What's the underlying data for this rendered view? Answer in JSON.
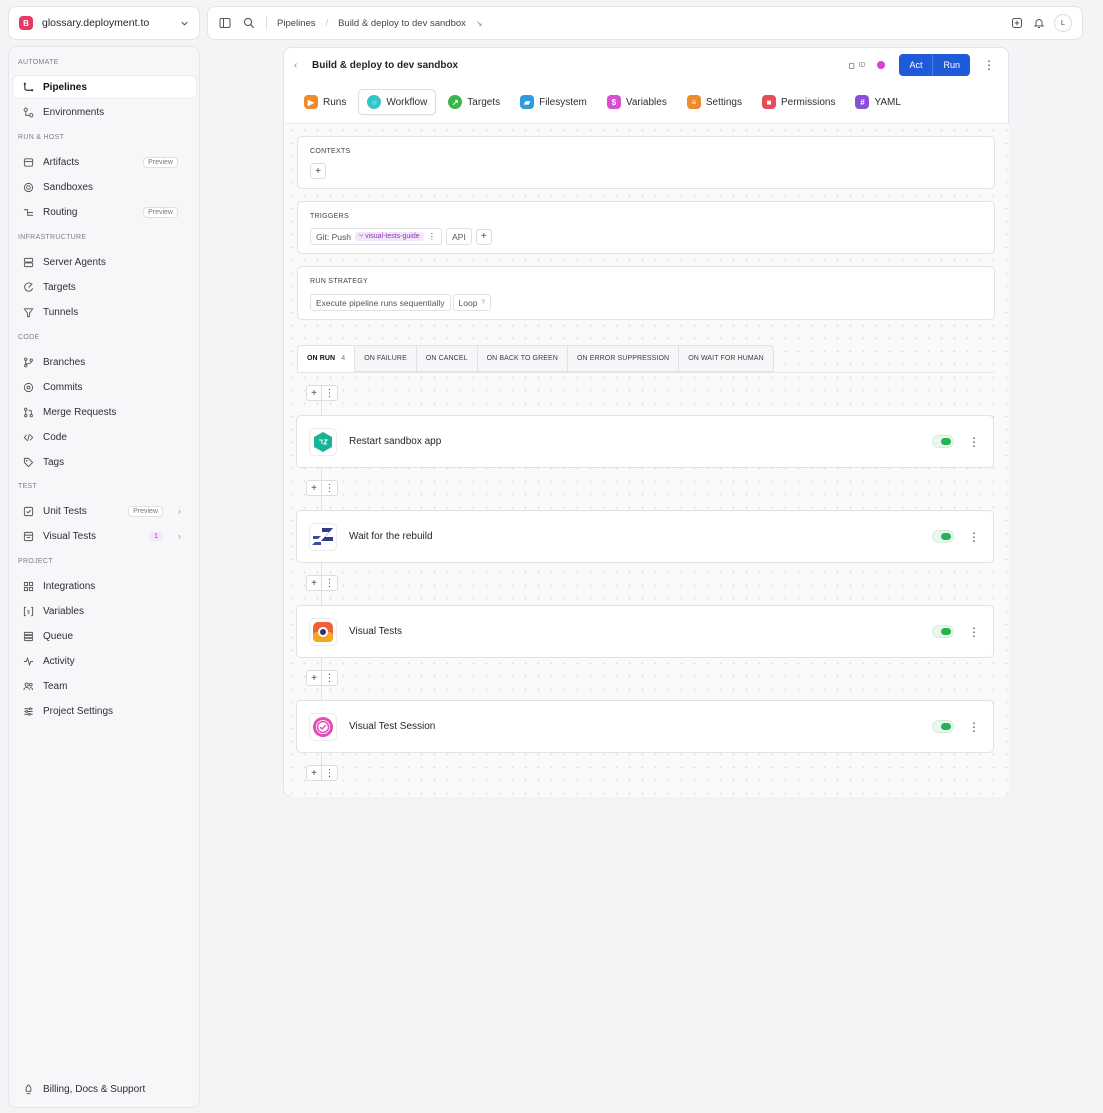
{
  "workspace": {
    "initial": "B",
    "name": "glossary.deployment.to"
  },
  "sidebar": {
    "sections": {
      "automate": "AUTOMATE",
      "run_host": "RUN & HOST",
      "infrastructure": "INFRASTRUCTURE",
      "code": "CODE",
      "test": "TEST",
      "project": "PROJECT"
    },
    "items": {
      "pipelines": "Pipelines",
      "environments": "Environments",
      "artifacts": "Artifacts",
      "sandboxes": "Sandboxes",
      "routing": "Routing",
      "server_agents": "Server Agents",
      "targets": "Targets",
      "tunnels": "Tunnels",
      "branches": "Branches",
      "commits": "Commits",
      "merge_requests": "Merge Requests",
      "code": "Code",
      "tags": "Tags",
      "unit_tests": "Unit Tests",
      "visual_tests": "Visual Tests",
      "integrations": "Integrations",
      "variables": "Variables",
      "queue": "Queue",
      "activity": "Activity",
      "team": "Team",
      "project_settings": "Project Settings",
      "billing": "Billing, Docs & Support"
    },
    "badges": {
      "preview": "Preview",
      "visual_tests_count": "1"
    }
  },
  "topbar": {
    "crumb_1": "Pipelines",
    "crumb_2": "Build & deploy to dev sandbox",
    "avatar": "L"
  },
  "panel": {
    "title": "Build & deploy to dev sandbox",
    "id_label": "ID",
    "act_label": "Act",
    "run_label": "Run",
    "tabs": {
      "runs": "Runs",
      "workflow": "Workflow",
      "targets": "Targets",
      "filesystem": "Filesystem",
      "variables": "Variables",
      "settings": "Settings",
      "permissions": "Permissions",
      "yaml": "YAML"
    },
    "contexts": {
      "label": "CONTEXTS"
    },
    "triggers": {
      "label": "TRIGGERS",
      "git_push": "Git: Push",
      "branch": "visual-tests-guide",
      "api": "API"
    },
    "run_strategy": {
      "label": "RUN STRATEGY",
      "mode": "Execute pipeline runs sequentially",
      "loop": "Loop"
    },
    "event_tabs": {
      "on_run": "ON RUN",
      "on_run_count": "4",
      "on_failure": "ON FAILURE",
      "on_cancel": "ON CANCEL",
      "on_back_to_green": "ON BACK TO GREEN",
      "on_error_suppression": "ON ERROR SUPPRESSION",
      "on_wait_for_human": "ON WAIT FOR HUMAN"
    },
    "actions": [
      {
        "name": "Restart sandbox app",
        "enabled": true
      },
      {
        "name": "Wait for the rebuild",
        "enabled": true
      },
      {
        "name": "Visual Tests",
        "enabled": true
      },
      {
        "name": "Visual Test Session",
        "enabled": true
      }
    ]
  },
  "colors": {
    "accent_blue": "#1f5bd8",
    "toggle_green": "#22b550",
    "workspace_logo": "#e53962"
  }
}
